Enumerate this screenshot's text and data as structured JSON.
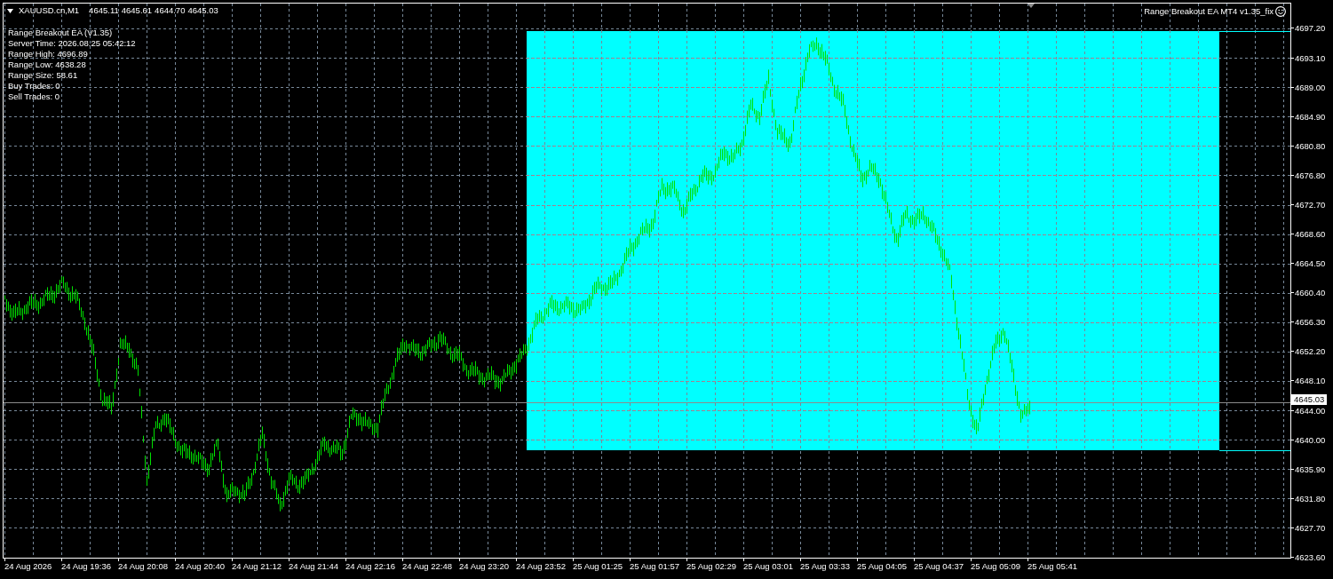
{
  "chart_header": {
    "symbol": "XAUUSD.cn,M1",
    "quotes": [
      "4645.11",
      "4645.61",
      "4644.70",
      "4645.03"
    ]
  },
  "ea_info": {
    "lines": [
      "Range Breakout EA (V1.35)",
      "Server Time: 2026.08.25 05:42:12",
      "Range High: 4696.89",
      "Range Low: 4638.28",
      "Range Size: 58.61",
      "Buy Trades: 0",
      "Sell Trades: 0"
    ]
  },
  "expert_advisor": {
    "name": "Range Breakout EA MT4 v1.35_fix",
    "trading_allowed": true
  },
  "price_axis": {
    "labels": [
      "4697.20",
      "4693.10",
      "4689.00",
      "4684.90",
      "4680.80",
      "4676.80",
      "4672.70",
      "4668.60",
      "4664.50",
      "4660.40",
      "4656.30",
      "4652.20",
      "4648.10",
      "4644.00",
      "4640.00",
      "4635.90",
      "4631.80",
      "4627.70",
      "4623.60"
    ],
    "current_price": "4645.03"
  },
  "time_axis": {
    "labels": [
      "24 Aug 2026",
      "24 Aug 19:36",
      "24 Aug 20:08",
      "24 Aug 20:40",
      "24 Aug 21:12",
      "24 Aug 21:44",
      "24 Aug 22:16",
      "24 Aug 22:48",
      "24 Aug 23:20",
      "24 Aug 23:52",
      "25 Aug 01:25",
      "25 Aug 01:57",
      "25 Aug 02:29",
      "25 Aug 03:01",
      "25 Aug 03:33",
      "25 Aug 04:05",
      "25 Aug 04:37",
      "25 Aug 05:09",
      "25 Aug 05:41"
    ]
  }
}
